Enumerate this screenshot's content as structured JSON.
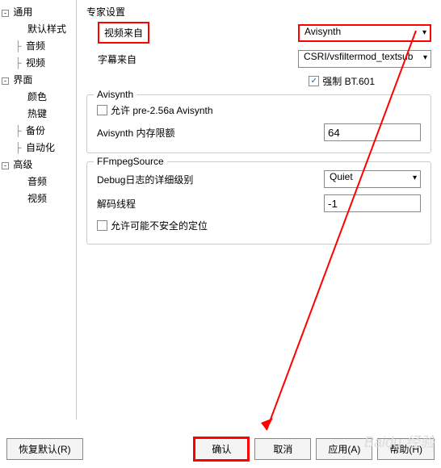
{
  "sidebar": {
    "items": [
      {
        "label": "通用",
        "level": 1,
        "expander": "-"
      },
      {
        "label": "默认样式",
        "level": 2
      },
      {
        "label": "音频",
        "level": 1,
        "connector": true
      },
      {
        "label": "视频",
        "level": 1,
        "connector": true
      },
      {
        "label": "界面",
        "level": 1,
        "expander": "-"
      },
      {
        "label": "颜色",
        "level": 2
      },
      {
        "label": "热键",
        "level": 2
      },
      {
        "label": "备份",
        "level": 1,
        "connector": true
      },
      {
        "label": "自动化",
        "level": 1,
        "connector": true
      },
      {
        "label": "高级",
        "level": 1,
        "expander": "-"
      },
      {
        "label": "音频",
        "level": 2
      },
      {
        "label": "视频",
        "level": 2
      }
    ]
  },
  "main": {
    "section_title": "专家设置",
    "video_from_label": "视频来自",
    "video_from_value": "Avisynth",
    "subtitle_from_label": "字幕来自",
    "subtitle_from_value": "CSRI/vsfiltermod_textsub",
    "force_bt601_label": "强制 BT.601",
    "force_bt601_checked": true,
    "avisynth_group": "Avisynth",
    "allow_pre256a_label": "允许 pre-2.56a Avisynth",
    "allow_pre256a_checked": false,
    "mem_limit_label": "Avisynth 内存限额",
    "mem_limit_value": "64",
    "ffmpeg_group": "FFmpegSource",
    "debug_level_label": "Debug日志的详细级别",
    "debug_level_value": "Quiet",
    "decode_threads_label": "解码线程",
    "decode_threads_value": "-1",
    "unsafe_seek_label": "允许可能不安全的定位",
    "unsafe_seek_checked": false
  },
  "buttons": {
    "restore_default": "恢复默认(R)",
    "ok": "确认",
    "cancel": "取消",
    "apply": "应用(A)",
    "help": "帮助(H)"
  },
  "watermark": "Baidu 经验"
}
